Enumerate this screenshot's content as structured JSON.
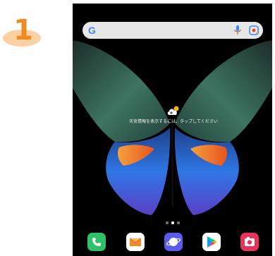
{
  "step": {
    "number": "1"
  },
  "search": {
    "logo": "G"
  },
  "weather": {
    "prompt": "天気情報を表示するには、タップしてください"
  },
  "home": {
    "pages": 3,
    "current_page": 2
  },
  "dock": {
    "apps": [
      {
        "name": "phone",
        "color": "#2fc167"
      },
      {
        "name": "messages",
        "color": "#ffffff"
      },
      {
        "name": "internet",
        "color": "#5a5cf0"
      },
      {
        "name": "play-store",
        "color": "#ffffff"
      },
      {
        "name": "camera",
        "color": "#e8345c"
      }
    ]
  },
  "colors": {
    "step_number": "#ef8a22",
    "step_blob": "#fbd1a3",
    "screen_bg": "#000000",
    "wing_green": "#2e5f4f",
    "wing_orange": "#f0702a",
    "wing_blue": "#2a6fe0"
  }
}
